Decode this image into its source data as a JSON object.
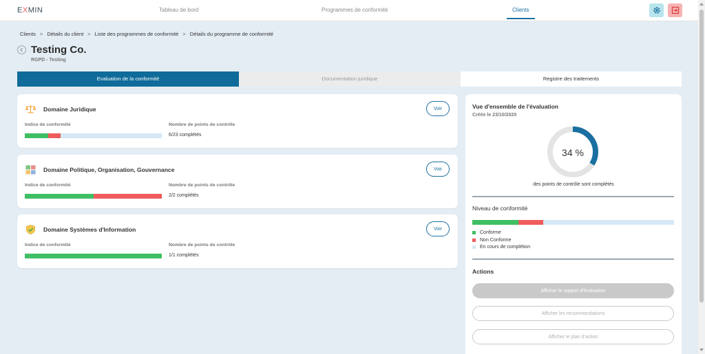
{
  "header": {
    "logo_prefix": "E",
    "logo_x": "X",
    "logo_suffix": "MIN",
    "nav": [
      "Tableau de bord",
      "Programmes de conformité",
      "Clients"
    ],
    "active_nav": "Clients"
  },
  "breadcrumb": [
    "Clients",
    "Détails du client",
    "Liste des programmes de conformité",
    "Détails du programme de conformité"
  ],
  "breadcrumb_separator": ">",
  "page": {
    "title": "Testing Co.",
    "subtitle": "RGPD - Testing"
  },
  "tabs": [
    "Evaluation de la conformité",
    "Documentation juridique",
    "Registre des traitements"
  ],
  "domains": [
    {
      "title": "Domaine Juridique",
      "icon": "balance-scale-icon",
      "voir": "Voir",
      "index_label": "Indice de conformité",
      "points_label": "Nombre de points de contrôle",
      "count": "6/23 complétés",
      "conforme_fraction": 0.17,
      "non_conforme_fraction": 0.09
    },
    {
      "title": "Domaine Politique, Organisation, Gouvernance",
      "icon": "puzzle-icon",
      "voir": "Voir",
      "index_label": "Indice de conformité",
      "points_label": "Nombre de points de contrôle",
      "count": "2/2 complétés",
      "conforme_fraction": 0.5,
      "non_conforme_fraction": 0.5
    },
    {
      "title": "Domaine Systèmes d'Information",
      "icon": "shield-check-icon",
      "voir": "Voir",
      "index_label": "Indice de conformité",
      "points_label": "Nombre de points de contrôle",
      "count": "1/1 complétés",
      "conforme_fraction": 1.0,
      "non_conforme_fraction": 0.0
    }
  ],
  "overview": {
    "title": "Vue d'ensemble de l'évaluation",
    "date": "Créée le 23/10/2020",
    "percent_value": 34,
    "percent_text": "34 %",
    "caption": "des points de contrôle sont complétés",
    "niveau_title": "Niveau de conformité",
    "niveau_conforme_fraction": 0.23,
    "niveau_non_conforme_fraction": 0.12,
    "legend": [
      "Conforme",
      "Non Conforme",
      "En cours de complétion"
    ],
    "actions_title": "Actions",
    "actions": [
      "Afficher le rapport d'évaluation",
      "Afficher les recommandations",
      "Afficher le plan d'action"
    ]
  },
  "colors": {
    "primary": "#0f6b99",
    "conforme": "#3fbf64",
    "non_conforme": "#ef5c5c",
    "en_cours": "#d5e8f5",
    "settings_bg": "#b8e4ec",
    "logout_bg": "#f7b3b3"
  }
}
